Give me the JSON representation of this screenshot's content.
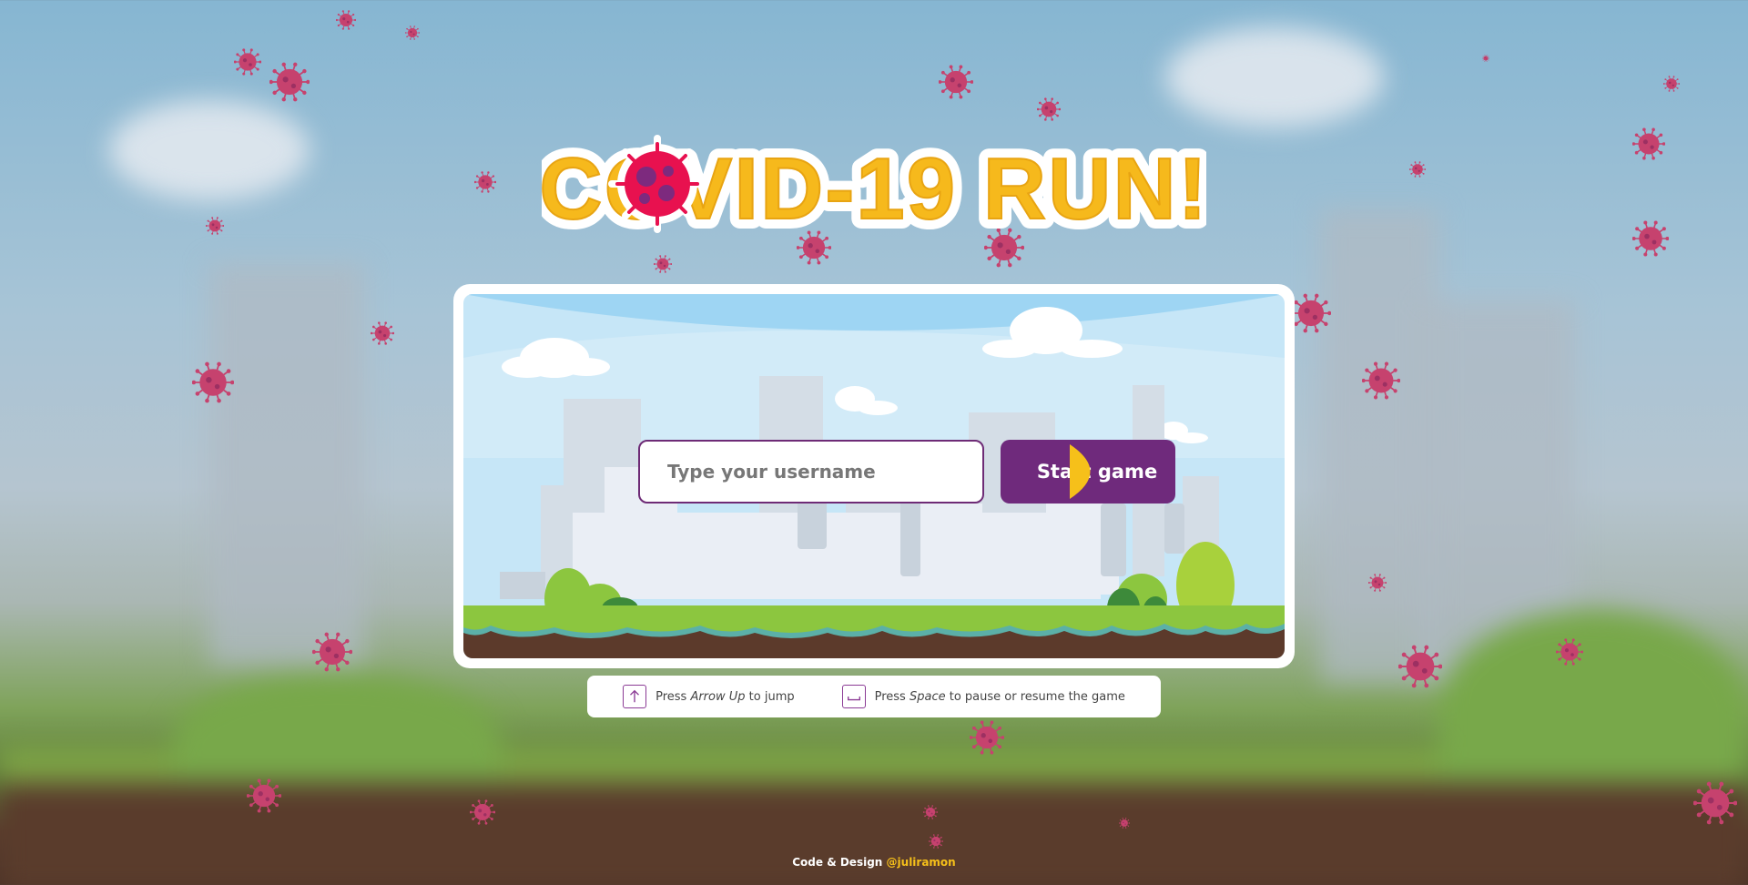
{
  "game": {
    "title": "COVID-19 RUN!"
  },
  "start_form": {
    "username_placeholder": "Type your username",
    "username_value": "",
    "start_label": "Start game"
  },
  "instructions": [
    {
      "icon": "arrow-up-key-icon",
      "prefix": "Press",
      "key": "Arrow Up",
      "suffix": "to jump"
    },
    {
      "icon": "space-key-icon",
      "prefix": "Press",
      "key": "Space",
      "suffix": "to pause or resume the game"
    }
  ],
  "footer": {
    "text": "Code & Design",
    "author": "@juliramon"
  },
  "colors": {
    "title_yellow": "#f6b91c",
    "virus_red": "#e8114f",
    "button_purple": "#6f2a7c",
    "footer_link": "#f6c01a",
    "background_virus": "#c6426e"
  }
}
